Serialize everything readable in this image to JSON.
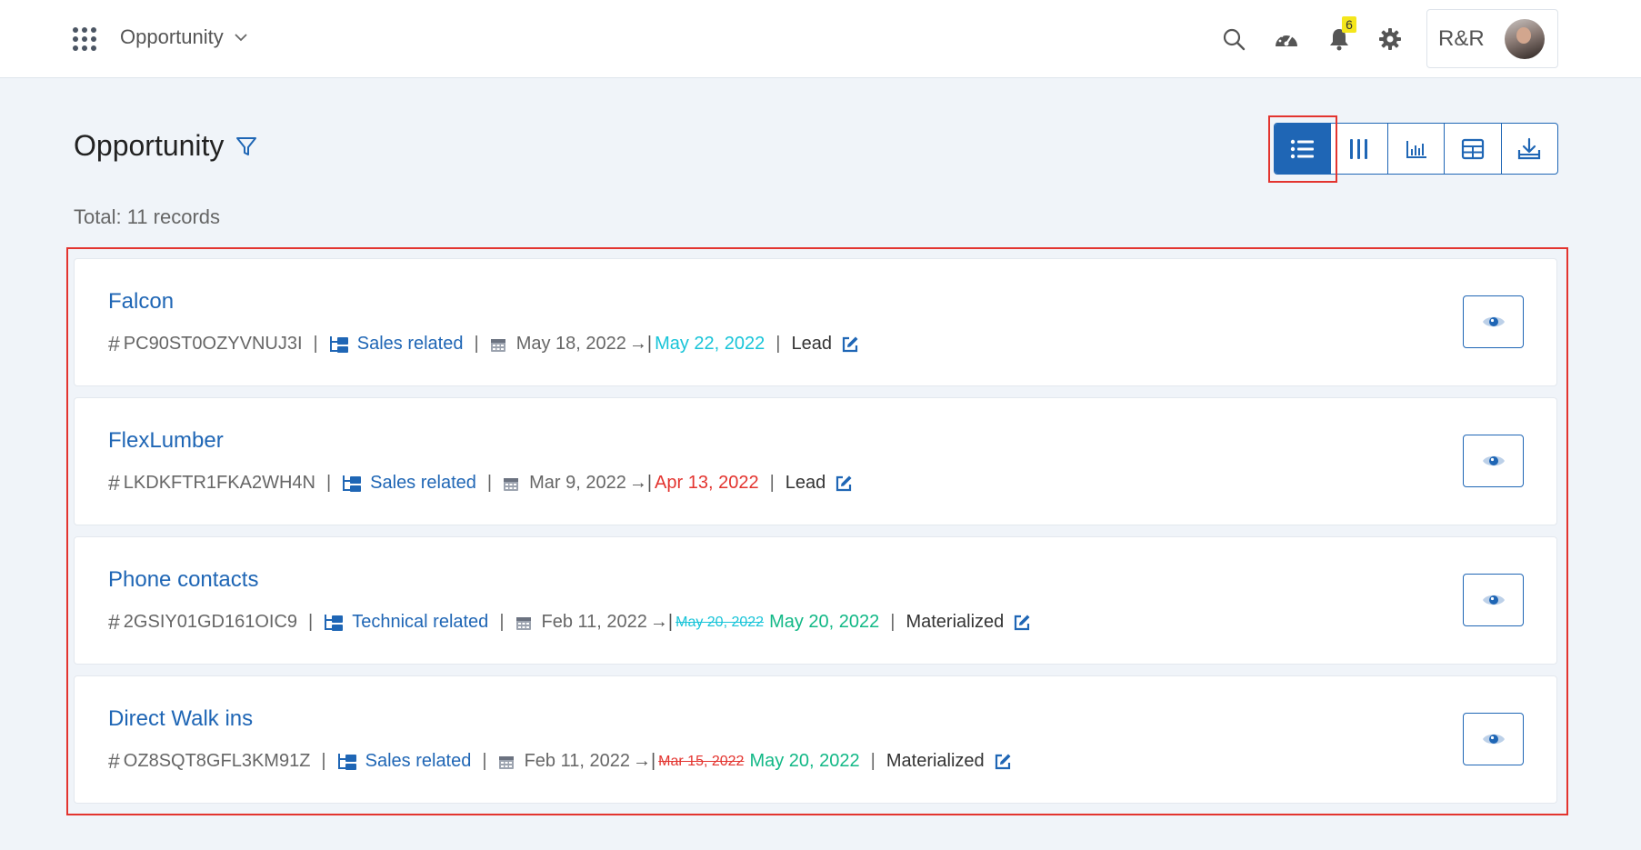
{
  "header": {
    "module": "Opportunity",
    "notification_count": "6",
    "user_initials": "R&R"
  },
  "page": {
    "title": "Opportunity",
    "total": "Total: 11 records"
  },
  "colors": {
    "primary": "#1f66b5",
    "end_date_cyan": "#18c4d8",
    "end_date_overdue": "#e3342f",
    "end_date_green": "#12b886",
    "highlight": "#e3342f"
  },
  "records": [
    {
      "title": "Falcon",
      "code": "PC90ST0OZYVNUJ3I",
      "category": "Sales related",
      "start_date": "May 18, 2022",
      "end_date": "May 22, 2022",
      "end_date_color": "#18c4d8",
      "old_end_date": "",
      "status": "Lead"
    },
    {
      "title": "FlexLumber",
      "code": "LKDKFTR1FKA2WH4N",
      "category": "Sales related",
      "start_date": "Mar 9, 2022",
      "end_date": "Apr 13, 2022",
      "end_date_color": "#e3342f",
      "old_end_date": "",
      "status": "Lead"
    },
    {
      "title": "Phone contacts",
      "code": "2GSIY01GD161OIC9",
      "category": "Technical related",
      "start_date": "Feb 11, 2022",
      "end_date": "May 20, 2022",
      "end_date_color": "#12b886",
      "old_end_date": "May 20, 2022",
      "old_end_date_style": "strike-blue",
      "status": "Materialized"
    },
    {
      "title": "Direct Walk ins",
      "code": "OZ8SQT8GFL3KM91Z",
      "category": "Sales related",
      "start_date": "Feb 11, 2022",
      "end_date": "May 20, 2022",
      "end_date_color": "#12b886",
      "old_end_date": "Mar 15, 2022",
      "old_end_date_style": "strike-red",
      "status": "Materialized"
    }
  ]
}
